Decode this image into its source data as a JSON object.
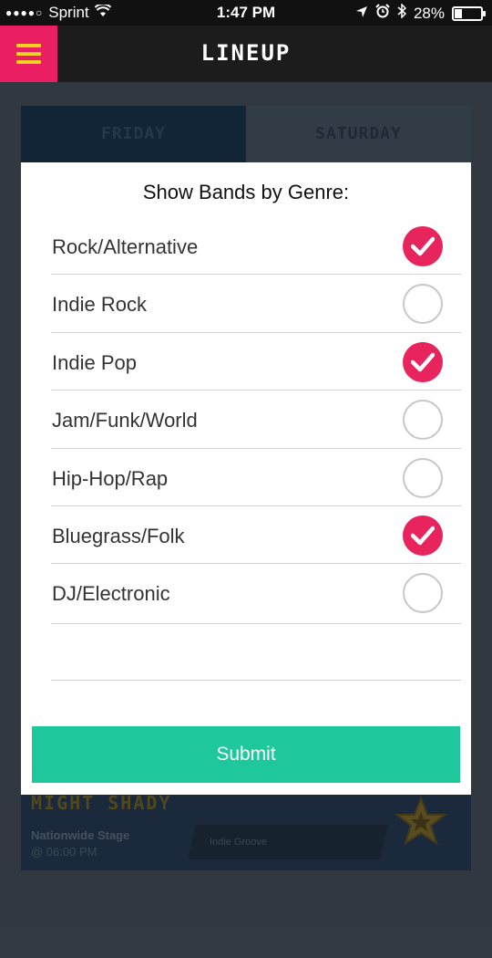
{
  "status_bar": {
    "carrier": "Sprint",
    "signal_dots": "●●●●○",
    "time": "1:47 PM",
    "battery": "28%",
    "battery_level": 0.28
  },
  "header": {
    "title": "LINEUP"
  },
  "background": {
    "tabs": [
      "FRIDAY",
      "SATURDAY"
    ],
    "card": {
      "band": "MIGHT SHADY",
      "stage": "Nationwide Stage",
      "time": "@ 06:00 PM",
      "genre": "Indie Groove"
    }
  },
  "modal": {
    "title": "Show Bands by Genre:",
    "genres": [
      {
        "label": "Rock/Alternative",
        "checked": true
      },
      {
        "label": "Indie Rock",
        "checked": false
      },
      {
        "label": "Indie Pop",
        "checked": true
      },
      {
        "label": "Jam/Funk/World",
        "checked": false
      },
      {
        "label": "Hip-Hop/Rap",
        "checked": false
      },
      {
        "label": "Bluegrass/Folk",
        "checked": true
      },
      {
        "label": "DJ/Electronic",
        "checked": false
      }
    ],
    "submit_label": "Submit"
  },
  "colors": {
    "accent_pink": "#e8245e",
    "menu_yellow": "#f8d21c",
    "submit_green": "#1ec79c"
  }
}
